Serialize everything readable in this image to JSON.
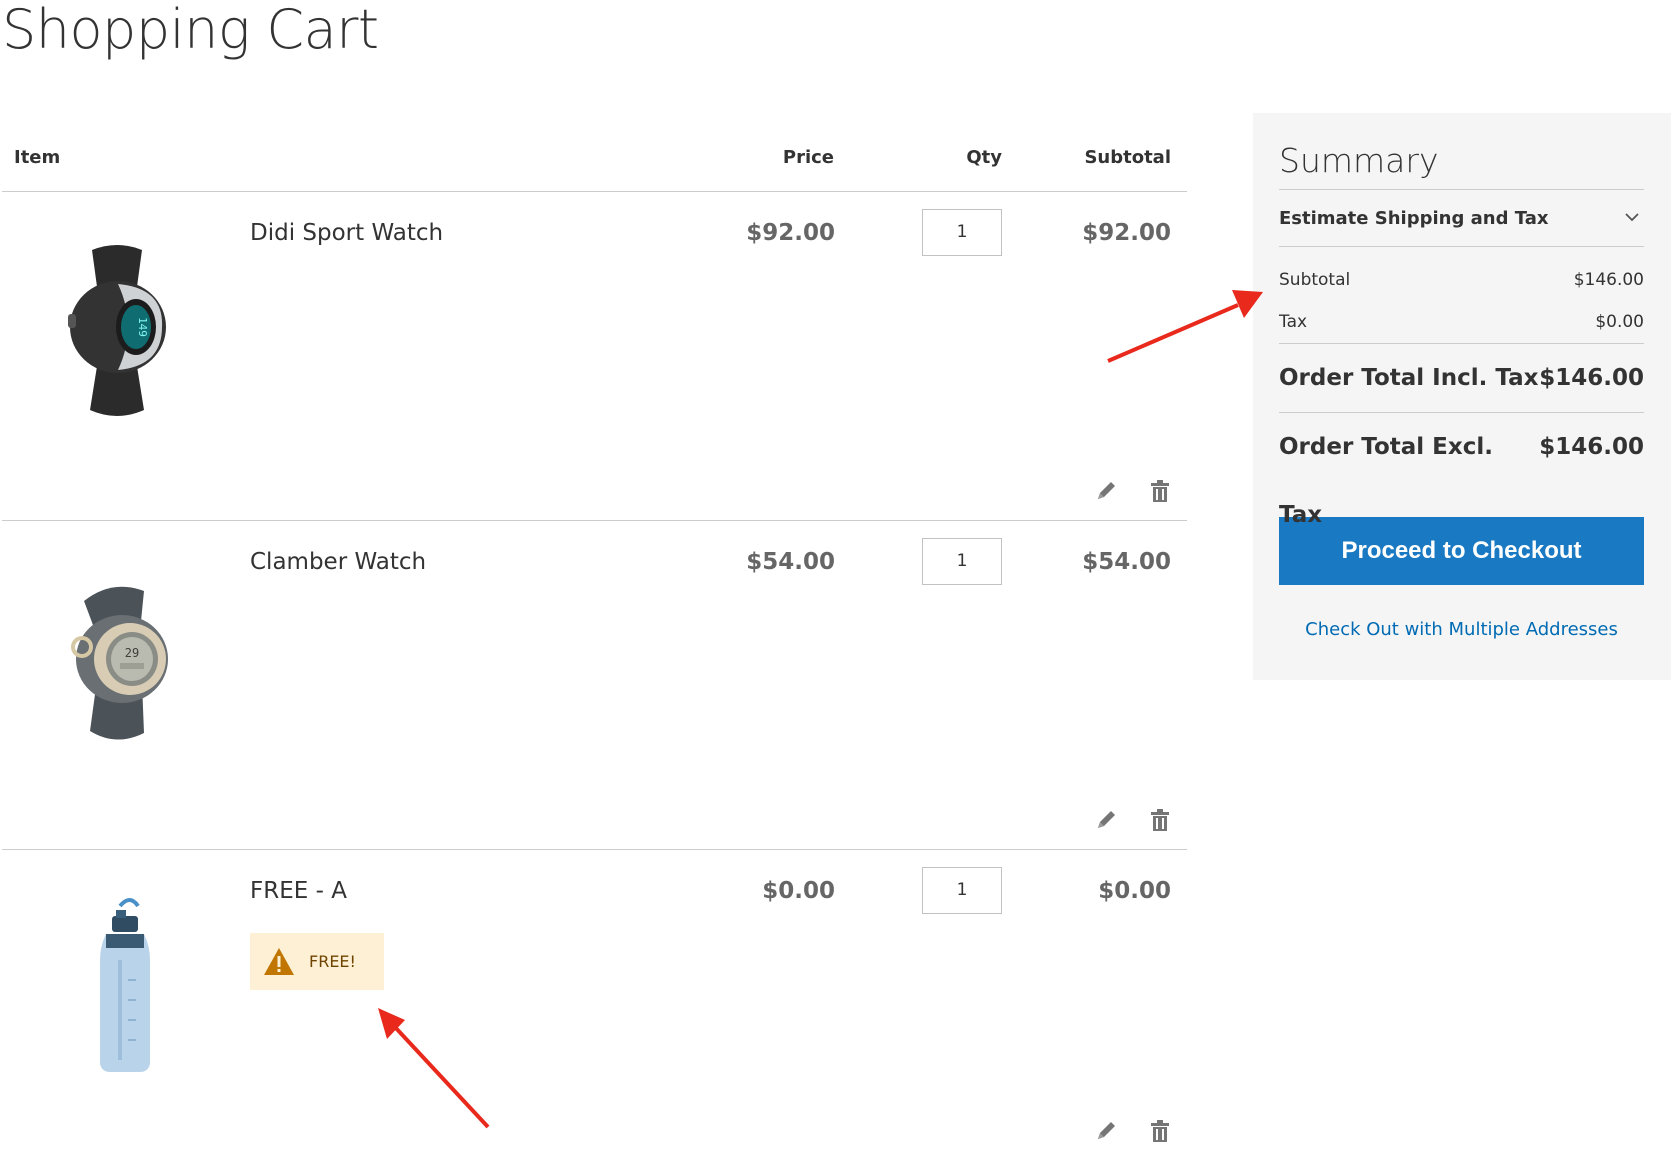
{
  "page": {
    "title": "Shopping Cart"
  },
  "table": {
    "headers": {
      "item": "Item",
      "price": "Price",
      "qty": "Qty",
      "subtotal": "Subtotal"
    },
    "items": [
      {
        "name": "Didi Sport Watch",
        "price": "$92.00",
        "qty": "1",
        "subtotal": "$92.00",
        "image_icon": "watch-icon"
      },
      {
        "name": "Clamber Watch",
        "price": "$54.00",
        "qty": "1",
        "subtotal": "$54.00",
        "image_icon": "watch-icon"
      },
      {
        "name": "FREE - A",
        "price": "$0.00",
        "qty": "1",
        "subtotal": "$0.00",
        "image_icon": "water-bottle-icon",
        "message": "FREE!"
      }
    ]
  },
  "summary": {
    "title": "Summary",
    "estimate_label": "Estimate Shipping and Tax",
    "subtotal_label": "Subtotal",
    "subtotal_value": "$146.00",
    "tax_label": "Tax",
    "tax_value": "$0.00",
    "incl_label": "Order Total Incl. Tax",
    "incl_value": "$146.00",
    "excl_label": "Order Total Excl. Tax",
    "excl_value": "$146.00",
    "checkout_label": "Proceed to Checkout",
    "multi_label": "Check Out with Multiple Addresses"
  },
  "colors": {
    "accent": "#1979c3",
    "link": "#006bb4",
    "message_bg": "#fdf0d5",
    "warning_icon": "#c07600",
    "annotation": "#e8291c"
  }
}
